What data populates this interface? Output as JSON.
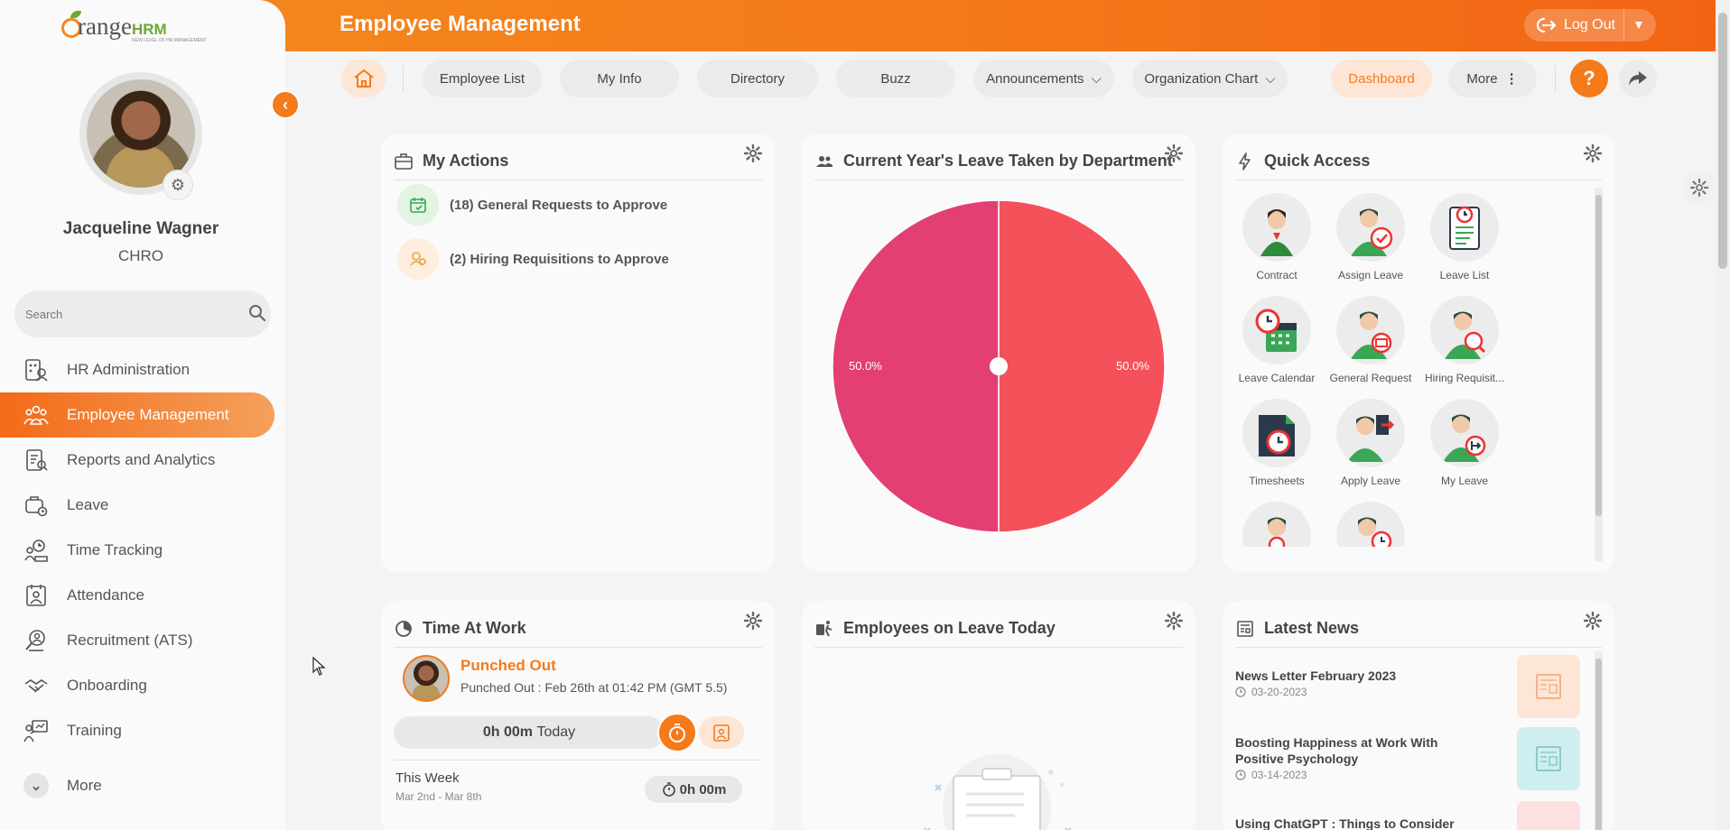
{
  "header": {
    "title": "Employee Management",
    "logout_label": "Log Out"
  },
  "sidebar": {
    "logo_text": "range",
    "logo_hrm": "HRM",
    "logo_tagline": "NEW LEVEL OF HR MANAGEMENT",
    "user_name": "Jacqueline Wagner",
    "user_role": "CHRO",
    "search_placeholder": "Search",
    "items": [
      {
        "label": "HR Administration",
        "icon": "hr-admin-icon"
      },
      {
        "label": "Employee Management",
        "icon": "employees-icon",
        "active": true
      },
      {
        "label": "Reports and Analytics",
        "icon": "reports-icon"
      },
      {
        "label": "Leave",
        "icon": "leave-icon"
      },
      {
        "label": "Time Tracking",
        "icon": "time-tracking-icon"
      },
      {
        "label": "Attendance",
        "icon": "attendance-icon"
      },
      {
        "label": "Recruitment (ATS)",
        "icon": "recruitment-icon"
      },
      {
        "label": "Onboarding",
        "icon": "onboarding-icon"
      },
      {
        "label": "Training",
        "icon": "training-icon"
      }
    ],
    "more_label": "More"
  },
  "topnav": {
    "items": [
      "Employee List",
      "My Info",
      "Directory",
      "Buzz",
      "Announcements",
      "Organization Chart",
      "Dashboard",
      "More"
    ],
    "active": "Dashboard"
  },
  "my_actions": {
    "title": "My Actions",
    "items": [
      {
        "label": "(18) General Requests to Approve"
      },
      {
        "label": "(2) Hiring Requisitions to Approve"
      }
    ]
  },
  "leave_by_department": {
    "title": "Current Year's Leave Taken by Department",
    "left_label": "50.0%",
    "right_label": "50.0%"
  },
  "chart_data": {
    "type": "pie",
    "title": "Current Year's Leave Taken by Department",
    "slices": [
      {
        "value": 50.0,
        "color": "#f4515a"
      },
      {
        "value": 50.0,
        "color": "#e33f72"
      }
    ]
  },
  "quick_access": {
    "title": "Quick Access",
    "items": [
      "Contract",
      "Assign Leave",
      "Leave List",
      "Leave Calendar",
      "General Request",
      "Hiring Requisit...",
      "Timesheets",
      "Apply Leave",
      "My Leave"
    ]
  },
  "time_at_work": {
    "title": "Time At Work",
    "status": "Punched Out",
    "detail": "Punched Out : Feb 26th at 01:42 PM (GMT 5.5)",
    "today_hours": "0h 00m",
    "today_label": "Today",
    "week_label": "This Week",
    "week_range": "Mar 2nd - Mar 8th",
    "week_hours": "0h 00m"
  },
  "on_leave": {
    "title": "Employees on Leave Today"
  },
  "latest_news": {
    "title": "Latest News",
    "items": [
      {
        "title": "News Letter February 2023",
        "date": "03-20-2023"
      },
      {
        "title": "Boosting Happiness at Work With Positive Psychology",
        "date": "03-14-2023"
      },
      {
        "title": "Using ChatGPT : Things to Consider",
        "date": ""
      }
    ]
  },
  "colors": {
    "brand_orange": "#f47a1a",
    "pie_red": "#f4515a",
    "pie_pink": "#e33f72"
  }
}
